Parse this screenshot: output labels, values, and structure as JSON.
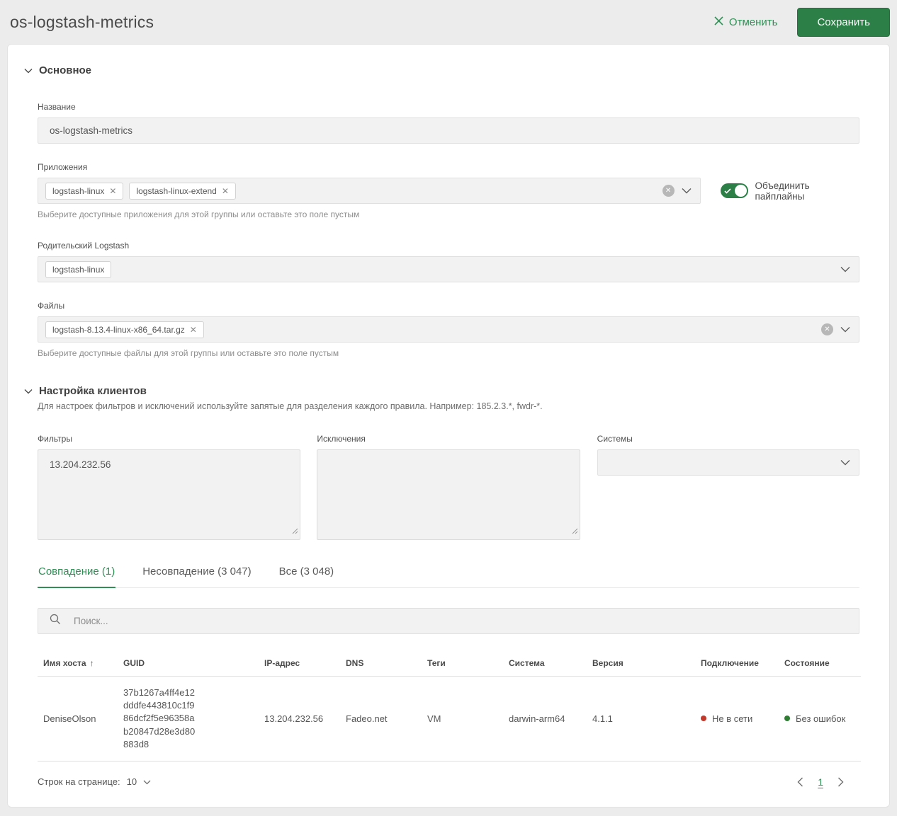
{
  "header": {
    "title": "os-logstash-metrics",
    "cancel_label": "Отменить",
    "save_label": "Сохранить"
  },
  "colors": {
    "accent_green": "#2f8f55",
    "save_button_green": "#2c7f46",
    "offline_red": "#c0392b",
    "ok_green": "#2e7d32",
    "page_background": "#ececec",
    "field_background": "#f2f2f2"
  },
  "main_section": {
    "title": "Основное",
    "name_field": {
      "label": "Название",
      "value": "os-logstash-metrics"
    },
    "applications_field": {
      "label": "Приложения",
      "tags": [
        "logstash-linux",
        "logstash-linux-extend"
      ],
      "hint": "Выберите доступные приложения для этой группы или оставьте это поле пустым"
    },
    "merge_toggle": {
      "label": "Объединить пайплайны",
      "state": "on"
    },
    "parent_field": {
      "label": "Родительский Logstash",
      "tags": [
        "logstash-linux"
      ]
    },
    "files_field": {
      "label": "Файлы",
      "tags": [
        "logstash-8.13.4-linux-x86_64.tar.gz"
      ],
      "hint": "Выберите доступные файлы для этой группы или оставьте это поле пустым"
    }
  },
  "clients_section": {
    "title": "Настройка клиентов",
    "description": "Для настроек фильтров и исключений используйте запятые для разделения каждого правила. Например: 185.2.3.*, fwdr-*.",
    "filters_field": {
      "label": "Фильтры",
      "value": "13.204.232.56"
    },
    "exclusions_field": {
      "label": "Исключения",
      "value": ""
    },
    "systems_field": {
      "label": "Системы",
      "value": ""
    }
  },
  "tabs": [
    {
      "label": "Совпадение (1)",
      "active": true
    },
    {
      "label": "Несовпадение (3 047)",
      "active": false
    },
    {
      "label": "Все (3 048)",
      "active": false
    }
  ],
  "search": {
    "placeholder": "Поиск..."
  },
  "table": {
    "columns": [
      "Имя хоста",
      "GUID",
      "IP-адрес",
      "DNS",
      "Теги",
      "Система",
      "Версия",
      "Подключение",
      "Состояние"
    ],
    "sort_column": "Имя хоста",
    "sort_direction": "asc",
    "rows": [
      {
        "hostname": "DeniseOlson",
        "guid": "37b1267a4ff4e12\ndddfe443810c1f9\n86dcf2f5e96358a\nb20847d28e3d80\n883d8",
        "ip": "13.204.232.56",
        "dns": "Fadeo.net",
        "tags": "VM",
        "system": "darwin-arm64",
        "version": "4.1.1",
        "connection": "Не в сети",
        "connection_status": "offline",
        "state": "Без ошибок",
        "state_status": "ok"
      }
    ]
  },
  "pagination": {
    "rows_per_page_label": "Строк на странице:",
    "rows_per_page": "10",
    "current_page": "1"
  }
}
